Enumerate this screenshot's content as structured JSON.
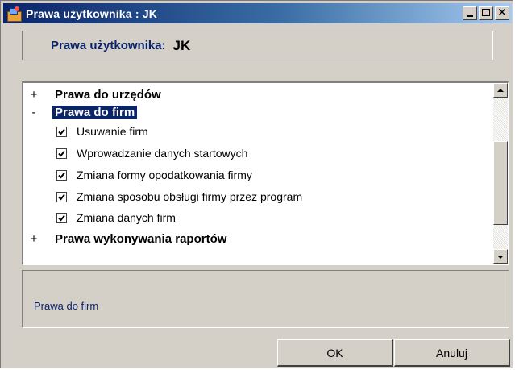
{
  "window": {
    "title": "Prawa użytkownika : JK",
    "minimize_icon": "minimize-icon",
    "maximize_icon": "maximize-icon",
    "close_icon": "close-icon",
    "close_glyph": "✕"
  },
  "header": {
    "label": "Prawa użytkownika:",
    "value": "JK"
  },
  "tree": {
    "groups": [
      {
        "expander": "+",
        "label": "Prawa do urzędów",
        "expanded": false,
        "selected": false
      },
      {
        "expander": "-",
        "label": "Prawa do firm",
        "expanded": true,
        "selected": true,
        "items": [
          {
            "label": "Usuwanie firm",
            "checked": true
          },
          {
            "label": "Wprowadzanie danych startowych",
            "checked": true
          },
          {
            "label": "Zmiana formy opodatkowania firmy",
            "checked": true
          },
          {
            "label": "Zmiana sposobu obsługi firmy przez program",
            "checked": true
          },
          {
            "label": "Zmiana danych firm",
            "checked": true
          }
        ]
      },
      {
        "expander": "+",
        "label": "Prawa wykonywania raportów",
        "expanded": false,
        "selected": false
      }
    ]
  },
  "description": {
    "text": "Prawa do firm"
  },
  "buttons": {
    "ok_label": "OK",
    "cancel_label": "Anuluj"
  },
  "colors": {
    "title_gradient_start": "#0a246a",
    "title_gradient_end": "#a6caf0",
    "selection": "#0a246a",
    "face": "#d4d0c8"
  }
}
